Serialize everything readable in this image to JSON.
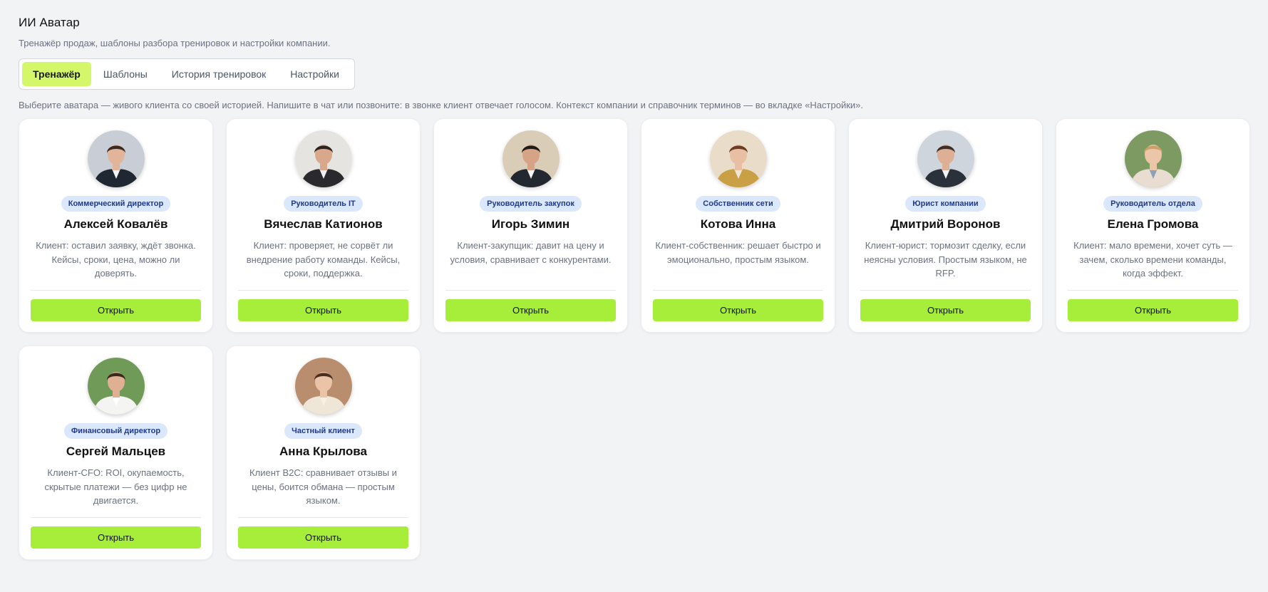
{
  "header": {
    "title": "ИИ Аватар",
    "subtitle": "Тренажёр продаж, шаблоны разбора тренировок и настройки компании."
  },
  "tabs": [
    {
      "label": "Тренажёр",
      "active": true
    },
    {
      "label": "Шаблоны",
      "active": false
    },
    {
      "label": "История тренировок",
      "active": false
    },
    {
      "label": "Настройки",
      "active": false
    }
  ],
  "hint": "Выберите аватара — живого клиента со своей историей. Напишите в чат или позвоните: в звонке клиент отвечает голосом. Контекст компании и справочник терминов — во вкладке «Настройки».",
  "colors": {
    "accent_button": "#a6ee3a",
    "active_tab": "#d4f76a",
    "badge_bg": "#dbe8fb",
    "badge_text": "#1e3a8a",
    "page_bg": "#f2f3f5"
  },
  "open_label": "Открыть",
  "avatars": [
    {
      "role": "Коммерческий директор",
      "name": "Алексей Ковалёв",
      "desc": "Клиент: оставил заявку, ждёт звонка. Кейсы, сроки, цена, можно ли доверять.",
      "photo": "man-in-suit-office-photo"
    },
    {
      "role": "Руководитель IT",
      "name": "Вячеслав Катионов",
      "desc": "Клиент: проверяет, не сорвёт ли внедрение работу команды. Кейсы, сроки, поддержка.",
      "photo": "man-with-glasses-portrait-photo"
    },
    {
      "role": "Руководитель закупок",
      "name": "Игорь Зимин",
      "desc": "Клиент-закупщик: давит на цену и условия, сравнивает с конкурентами.",
      "photo": "man-at-desk-photo"
    },
    {
      "role": "Собственник сети",
      "name": "Котова Инна",
      "desc": "Клиент-собственник: решает быстро и эмоционально, простым языком.",
      "photo": "woman-with-scarf-photo"
    },
    {
      "role": "Юрист компании",
      "name": "Дмитрий Воронов",
      "desc": "Клиент-юрист: тормозит сделку, если неясны условия. Простым языком, не RFP.",
      "photo": "man-at-laptop-photo"
    },
    {
      "role": "Руководитель отдела",
      "name": "Елена Громова",
      "desc": "Клиент: мало времени, хочет суть — зачем, сколько времени команды, когда эффект.",
      "photo": "woman-outdoors-photo"
    },
    {
      "role": "Финансовый директор",
      "name": "Сергей Мальцев",
      "desc": "Клиент-CFO: ROI, окупаемость, скрытые платежи — без цифр не двигается.",
      "photo": "man-white-shirt-outdoors-photo"
    },
    {
      "role": "Частный клиент",
      "name": "Анна Крылова",
      "desc": "Клиент B2C: сравнивает отзывы и цены, боится обмана — простым языком.",
      "photo": "woman-in-cafe-photo"
    }
  ]
}
